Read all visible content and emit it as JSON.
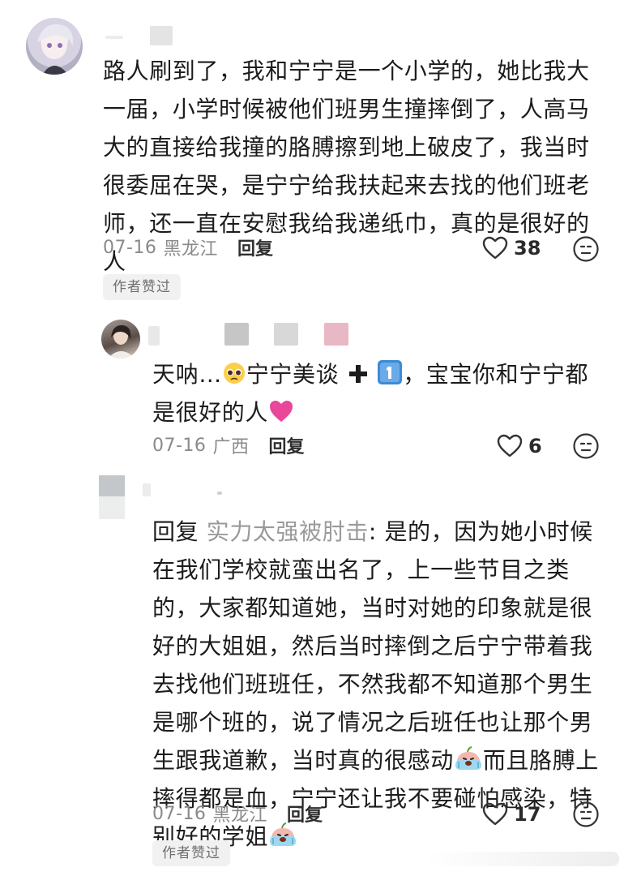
{
  "comments": [
    {
      "text": "路人刷到了，我和宁宁是一个小学的，她比我大一届，小学时候被他们班男生撞摔倒了，人高马大的直接给我撞的胳膊擦到地上破皮了，我当时很委屈在哭，是宁宁给我扶起来去找的他们班老师，还一直在安慰我给我递纸巾，真的是很好的人",
      "date": "07-16",
      "location": "黑龙江",
      "reply_label": "回复",
      "likes": "38",
      "badge": "作者赞过"
    },
    {
      "text_part1": "天呐…",
      "text_part2": "宁宁美谈",
      "text_part3": "，宝宝你和宁宁都是很好的人",
      "date": "07-16",
      "location": "广西",
      "reply_label": "回复",
      "likes": "6"
    },
    {
      "reply_prefix": "回复",
      "reply_to": "实力太强被肘击",
      "text_part1": ": 是的，因为她小时候在我们学校就蛮出名了，上一些节目之类的，大家都知道她，当时对她的印象就是很好的大姐姐，然后当时摔倒之后宁宁带着我去找他们班班任，不然我都不知道那个男生是哪个班的，说了情况之后班任也让那个男生跟我道歉，当时真的很感动",
      "text_part2": "而且胳膊上摔得都是血，宁宁还让我不要碰怕感染，特别好的学姐",
      "date": "07-16",
      "location": "黑龙江",
      "reply_label": "回复",
      "likes": "17",
      "badge": "作者赞过"
    }
  ],
  "colors": {
    "heart": "#e8479a",
    "text": "#1c1c1c",
    "meta": "#8a8a8a"
  },
  "icons": [
    "heart-outline-icon",
    "neutral-face-icon",
    "plus-icon",
    "keycap-1-icon",
    "pleading-face-icon",
    "crying-face-icon",
    "pink-heart-icon"
  ]
}
